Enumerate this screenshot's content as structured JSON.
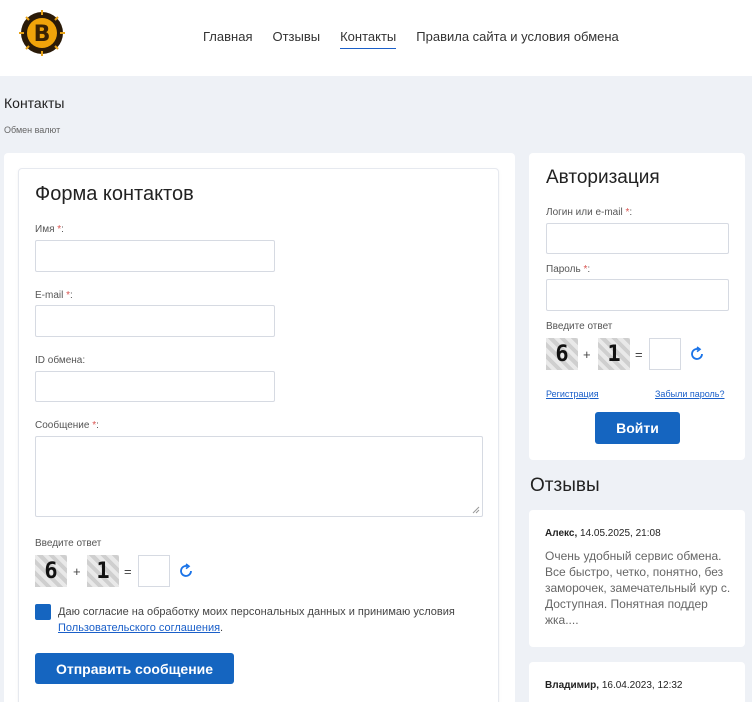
{
  "nav": {
    "items": [
      {
        "label": "Главная"
      },
      {
        "label": "Отзывы"
      },
      {
        "label": "Контакты"
      },
      {
        "label": "Правила сайта и условия обмена"
      }
    ],
    "active_index": 2
  },
  "page": {
    "title": "Контакты",
    "breadcrumb": "Обмен валют"
  },
  "contact_form": {
    "title": "Форма контактов",
    "name_label": "Имя",
    "email_label": "E-mail",
    "exchange_id_label": "ID обмена:",
    "message_label": "Сообщение",
    "required_mark": "*",
    "colon": ":",
    "captcha_label": "Введите ответ",
    "captcha_a": "6",
    "captcha_b": "1",
    "captcha_plus": "+",
    "captcha_eq": "=",
    "consent_text": "Даю согласие на обработку моих персональных данных и принимаю условия",
    "consent_link": "Пользовательского соглашения",
    "consent_end": ".",
    "submit_label": "Отправить сообщение"
  },
  "auth": {
    "title": "Авторизация",
    "login_label": "Логин или e-mail",
    "password_label": "Пароль",
    "required_mark": "*",
    "colon": ":",
    "captcha_label": "Введите ответ",
    "captcha_a": "6",
    "captcha_b": "1",
    "captcha_plus": "+",
    "captcha_eq": "=",
    "register_link": "Регистрация",
    "forgot_link": "Забыли пароль?",
    "login_button": "Войти"
  },
  "reviews": {
    "title": "Отзывы",
    "items": [
      {
        "author": "Алекс,",
        "date": "14.05.2025, 21:08",
        "text": "Очень удобный сервис обмена. Все быстро, четко, понятно, без заморочек, замечательный кур с. Доступная. Понятная поддер жка...."
      },
      {
        "author": "Владимир,",
        "date": "16.04.2023, 12:32",
        "text": ""
      }
    ]
  },
  "colors": {
    "accent": "#1565c0",
    "link": "#1a5fc9",
    "background": "#eef1f6"
  },
  "icons": {
    "logo": "bitcoin-logo",
    "refresh": "refresh-icon"
  }
}
